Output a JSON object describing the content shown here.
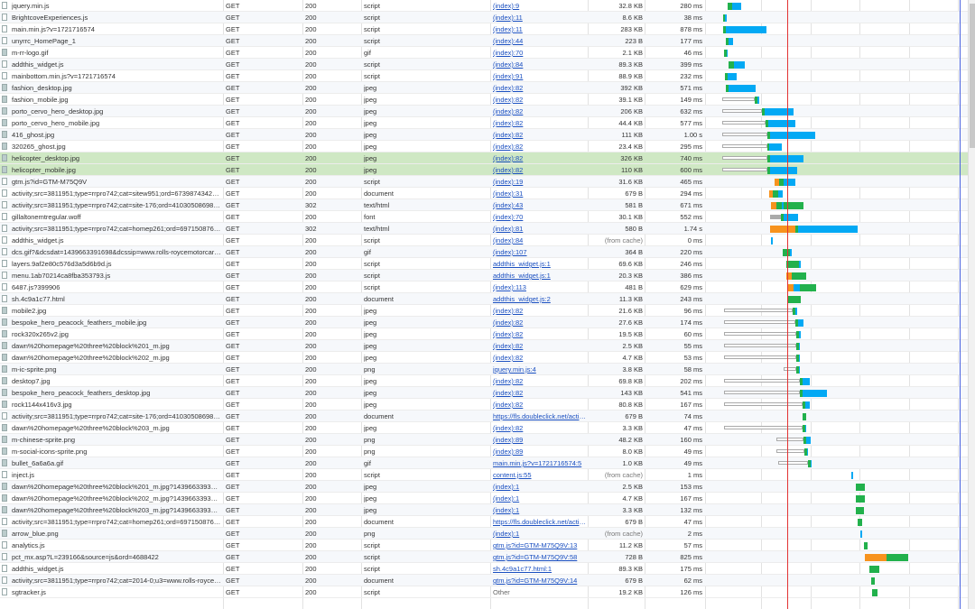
{
  "timeline": {
    "load_color": "#e33333",
    "dom_color": "#4a63e0"
  },
  "requests": [
    {
      "name": "jquery.min.js",
      "method": "GET",
      "status": "200",
      "type": "script",
      "initiator": "(index):9",
      "size": "32.8 KB",
      "time": "280 ms",
      "icon": "file-icon",
      "wf": {
        "s": 806,
        "w": 5,
        "r": 10
      }
    },
    {
      "name": "BrightcoveExperiences.js",
      "method": "GET",
      "status": "200",
      "type": "script",
      "initiator": "(index):11",
      "size": "8.6 KB",
      "time": "38 ms",
      "icon": "file-icon",
      "wf": {
        "s": 801,
        "w": 2,
        "r": 2
      }
    },
    {
      "name": "main.min.js?v=1721716574",
      "method": "GET",
      "status": "200",
      "type": "script",
      "initiator": "(index):11",
      "size": "283 KB",
      "time": "878 ms",
      "icon": "file-icon",
      "wf": {
        "s": 801,
        "w": 3,
        "r": 45
      }
    },
    {
      "name": "unyrrc_HomePage_1",
      "method": "GET",
      "status": "200",
      "type": "script",
      "initiator": "(index):44",
      "size": "223 B",
      "time": "177 ms",
      "icon": "file-icon",
      "wf": {
        "s": 804,
        "w": 3,
        "r": 5
      }
    },
    {
      "name": "m-rr-logo.gif",
      "method": "GET",
      "status": "200",
      "type": "gif",
      "initiator": "(index):70",
      "size": "2.1 KB",
      "time": "46 ms",
      "icon": "image-icon",
      "wf": {
        "s": 802,
        "w": 3,
        "r": 1
      }
    },
    {
      "name": "addthis_widget.js",
      "method": "GET",
      "status": "200",
      "type": "script",
      "initiator": "(index):84",
      "size": "89.3 KB",
      "time": "399 ms",
      "icon": "file-icon",
      "wf": {
        "s": 807,
        "w": 6,
        "r": 12
      }
    },
    {
      "name": "mainbottom.min.js?v=1721716574",
      "method": "GET",
      "status": "200",
      "type": "script",
      "initiator": "(index):91",
      "size": "88.9 KB",
      "time": "232 ms",
      "icon": "file-icon",
      "wf": {
        "s": 803,
        "w": 3,
        "r": 10
      }
    },
    {
      "name": "fashion_desktop.jpg",
      "method": "GET",
      "status": "200",
      "type": "jpeg",
      "initiator": "(index):82",
      "size": "392 KB",
      "time": "571 ms",
      "icon": "image-icon",
      "wf": {
        "s": 804,
        "w": 3,
        "r": 30
      }
    },
    {
      "name": "fashion_mobile.jpg",
      "method": "GET",
      "status": "200",
      "type": "jpeg",
      "initiator": "(index):82",
      "size": "39.1 KB",
      "time": "149 ms",
      "icon": "image-icon",
      "wf": {
        "s": 800,
        "p": 36,
        "w": 3,
        "r": 2
      }
    },
    {
      "name": "porto_cervo_hero_desktop.jpg",
      "method": "GET",
      "status": "200",
      "type": "jpeg",
      "initiator": "(index):82",
      "size": "206 KB",
      "time": "632 ms",
      "icon": "image-icon",
      "wf": {
        "s": 800,
        "p": 44,
        "w": 3,
        "r": 32
      }
    },
    {
      "name": "porto_cervo_hero_mobile.jpg",
      "method": "GET",
      "status": "200",
      "type": "jpeg",
      "initiator": "(index):82",
      "size": "44.4 KB",
      "time": "577 ms",
      "icon": "image-icon",
      "wf": {
        "s": 800,
        "p": 48,
        "w": 3,
        "r": 30
      }
    },
    {
      "name": "416_ghost.jpg",
      "method": "GET",
      "status": "200",
      "type": "jpeg",
      "initiator": "(index):82",
      "size": "111 KB",
      "time": "1.00 s",
      "icon": "image-icon",
      "wf": {
        "s": 800,
        "p": 50,
        "w": 3,
        "r": 50
      }
    },
    {
      "name": "320265_ghost.jpg",
      "method": "GET",
      "status": "200",
      "type": "jpeg",
      "initiator": "(index):82",
      "size": "23.4 KB",
      "time": "295 ms",
      "icon": "image-icon",
      "wf": {
        "s": 800,
        "p": 50,
        "w": 2,
        "r": 14
      }
    },
    {
      "name": "helicopter_desktop.jpg",
      "method": "GET",
      "status": "200",
      "type": "jpeg",
      "initiator": "(index):82",
      "size": "326 KB",
      "time": "740 ms",
      "icon": "image-icon",
      "hl": true,
      "wf": {
        "s": 800,
        "p": 50,
        "w": 3,
        "r": 37
      }
    },
    {
      "name": "helicopter_mobile.jpg",
      "method": "GET",
      "status": "200",
      "type": "jpeg",
      "initiator": "(index):82",
      "size": "110 KB",
      "time": "600 ms",
      "icon": "image-icon",
      "hl": true,
      "wf": {
        "s": 800,
        "p": 50,
        "w": 3,
        "r": 30
      }
    },
    {
      "name": "gtm.js?id=GTM-M75Q9V",
      "method": "GET",
      "status": "200",
      "type": "script",
      "initiator": "(index):19",
      "size": "31.6 KB",
      "time": "465 ms",
      "icon": "file-icon",
      "wf": {
        "s": 858,
        "w": 5,
        "o": 5,
        "r": 13
      }
    },
    {
      "name": "activity;src=3811951;type=rrpro742;cat=sitew951;ord=6739874342456.46",
      "method": "GET",
      "status": "200",
      "type": "document",
      "initiator": "(index):31",
      "size": "679 B",
      "time": "294 ms",
      "icon": "file-icon",
      "wf": {
        "s": 852,
        "o": 4,
        "w": 6,
        "r": 5
      }
    },
    {
      "name": "activity;src=3811951;type=rrpro742;cat=site-176;ord=4103050869889.95575",
      "method": "GET",
      "status": "302",
      "type": "text/html",
      "initiator": "(index):43",
      "size": "581 B",
      "time": "671 ms",
      "icon": "file-icon",
      "wf": {
        "s": 854,
        "o": 6,
        "w": 6,
        "r": 2,
        "w2": 22
      }
    },
    {
      "name": "gillaltonemtregular.woff",
      "method": "GET",
      "status": "200",
      "type": "font",
      "initiator": "(index):70",
      "size": "30.1 KB",
      "time": "552 ms",
      "icon": "file-icon",
      "wf": {
        "s": 853,
        "q": 12,
        "w": 3,
        "r": 16
      }
    },
    {
      "name": "activity;src=3811951;type=rrpro742;cat=homep261;ord=6971508769784...",
      "method": "GET",
      "status": "302",
      "type": "text/html",
      "initiator": "(index):81",
      "size": "580 B",
      "time": "1.74 s",
      "icon": "file-icon",
      "wf": {
        "s": 853,
        "o": 28,
        "w": 3,
        "r": 66
      }
    },
    {
      "name": "addthis_widget.js",
      "method": "GET",
      "status": "200",
      "type": "script",
      "initiator": "(index):84",
      "size": "(from cache)",
      "time": "0 ms",
      "icon": "file-icon",
      "cache": true,
      "wf": {
        "s": 854,
        "r": 2
      }
    },
    {
      "name": "dcs.gif?&dcsdat=1439663391698&dcssip=www.rolls-roycemotorcars.com...",
      "method": "GET",
      "status": "200",
      "type": "gif",
      "initiator": "(index):107",
      "size": "364 B",
      "time": "220 ms",
      "icon": "file-icon",
      "wf": {
        "s": 867,
        "w": 8,
        "r": 2
      }
    },
    {
      "name": "layers.9af2e80c576d3a5d6b9d.js",
      "method": "GET",
      "status": "200",
      "type": "script",
      "initiator": "addthis_widget.js:1",
      "size": "69.6 KB",
      "time": "246 ms",
      "icon": "file-icon",
      "wf": {
        "s": 871,
        "w": 14,
        "r": 2
      }
    },
    {
      "name": "menu.1ab70214ca8fba353793.js",
      "method": "GET",
      "status": "200",
      "type": "script",
      "initiator": "addthis_widget.js:1",
      "size": "20.3 KB",
      "time": "386 ms",
      "icon": "file-icon",
      "wf": {
        "s": 871,
        "o": 6,
        "w": 16
      }
    },
    {
      "name": "6487.js?399906",
      "method": "GET",
      "status": "200",
      "type": "script",
      "initiator": "(index):113",
      "size": "481 B",
      "time": "629 ms",
      "icon": "file-icon",
      "wf": {
        "s": 872,
        "o": 7,
        "r": 7,
        "w2": 18
      }
    },
    {
      "name": "sh.4c9a1c77.html",
      "method": "GET",
      "status": "200",
      "type": "document",
      "initiator": "addthis_widget.js:2",
      "size": "11.3 KB",
      "time": "243 ms",
      "icon": "file-icon",
      "wf": {
        "s": 872,
        "w": 15
      }
    },
    {
      "name": "mobile2.jpg",
      "method": "GET",
      "status": "200",
      "type": "jpeg",
      "initiator": "(index):82",
      "size": "21.6 KB",
      "time": "96 ms",
      "icon": "image-icon",
      "wf": {
        "s": 802,
        "p": 76,
        "w": 3,
        "r": 2
      }
    },
    {
      "name": "bespoke_hero_peacock_feathers_mobile.jpg",
      "method": "GET",
      "status": "200",
      "type": "jpeg",
      "initiator": "(index):82",
      "size": "27.6 KB",
      "time": "174 ms",
      "icon": "image-icon",
      "wf": {
        "s": 802,
        "p": 79,
        "w": 3,
        "r": 6
      }
    },
    {
      "name": "rock320x265v2.jpg",
      "method": "GET",
      "status": "200",
      "type": "jpeg",
      "initiator": "(index):82",
      "size": "19.5 KB",
      "time": "60 ms",
      "icon": "image-icon",
      "wf": {
        "s": 802,
        "p": 80,
        "w": 3,
        "r": 2
      }
    },
    {
      "name": "dawn%20homepage%20three%20block%201_m.jpg",
      "method": "GET",
      "status": "200",
      "type": "jpeg",
      "initiator": "(index):82",
      "size": "2.5 KB",
      "time": "55 ms",
      "icon": "image-icon",
      "wf": {
        "s": 802,
        "p": 80,
        "w": 3,
        "r": 1
      }
    },
    {
      "name": "dawn%20homepage%20three%20block%202_m.jpg",
      "method": "GET",
      "status": "200",
      "type": "jpeg",
      "initiator": "(index):82",
      "size": "4.7 KB",
      "time": "53 ms",
      "icon": "image-icon",
      "wf": {
        "s": 802,
        "p": 80,
        "w": 3,
        "r": 1
      }
    },
    {
      "name": "m-ic-sprite.png",
      "method": "GET",
      "status": "200",
      "type": "png",
      "initiator": "jquery.min.js:4",
      "size": "3.8 KB",
      "time": "58 ms",
      "icon": "image-icon",
      "wf": {
        "s": 868,
        "p": 14,
        "w": 3,
        "r": 1
      }
    },
    {
      "name": "desktop7.jpg",
      "method": "GET",
      "status": "200",
      "type": "jpeg",
      "initiator": "(index):82",
      "size": "69.8 KB",
      "time": "202 ms",
      "icon": "image-icon",
      "wf": {
        "s": 802,
        "p": 84,
        "w": 3,
        "r": 8
      }
    },
    {
      "name": "bespoke_hero_peacock_feathers_desktop.jpg",
      "method": "GET",
      "status": "200",
      "type": "jpeg",
      "initiator": "(index):82",
      "size": "143 KB",
      "time": "541 ms",
      "icon": "image-icon",
      "wf": {
        "s": 802,
        "p": 84,
        "w": 3,
        "r": 27
      }
    },
    {
      "name": "rock1144x416v3.jpg",
      "method": "GET",
      "status": "200",
      "type": "jpeg",
      "initiator": "(index):82",
      "size": "80.8 KB",
      "time": "167 ms",
      "icon": "image-icon",
      "wf": {
        "s": 802,
        "p": 87,
        "w": 3,
        "r": 5
      }
    },
    {
      "name": "activity;src=3811951;type=rrpro742;cat=site-176;ord=4103050869889.95575",
      "method": "GET",
      "status": "200",
      "type": "document",
      "initiator": "https://fls.doubleclick.net/activit...",
      "size": "679 B",
      "time": "74 ms",
      "icon": "file-icon",
      "wf": {
        "s": 889,
        "w": 4
      }
    },
    {
      "name": "dawn%20homepage%20three%20block%203_m.jpg",
      "method": "GET",
      "status": "200",
      "type": "jpeg",
      "initiator": "(index):82",
      "size": "3.3 KB",
      "time": "47 ms",
      "icon": "image-icon",
      "wf": {
        "s": 802,
        "p": 87,
        "w": 3,
        "r": 1
      }
    },
    {
      "name": "m-chinese-sprite.png",
      "method": "GET",
      "status": "200",
      "type": "png",
      "initiator": "(index):89",
      "size": "48.2 KB",
      "time": "160 ms",
      "icon": "image-icon",
      "wf": {
        "s": 860,
        "p": 30,
        "w": 3,
        "r": 5
      }
    },
    {
      "name": "m-social-icons-sprite.png",
      "method": "GET",
      "status": "200",
      "type": "png",
      "initiator": "(index):89",
      "size": "8.0 KB",
      "time": "49 ms",
      "icon": "image-icon",
      "wf": {
        "s": 860,
        "p": 31,
        "w": 3,
        "r": 1
      }
    },
    {
      "name": "bullet_6a6a6a.gif",
      "method": "GET",
      "status": "200",
      "type": "gif",
      "initiator": "main.min.js?v=1721716574:5",
      "size": "1.0 KB",
      "time": "49 ms",
      "icon": "image-icon",
      "wf": {
        "s": 862,
        "p": 33,
        "w": 3,
        "r": 1
      }
    },
    {
      "name": "inject.js",
      "method": "GET",
      "status": "200",
      "type": "script",
      "initiator": "content.js:55",
      "size": "(from cache)",
      "time": "1 ms",
      "icon": "file-icon",
      "cache": true,
      "wf": {
        "s": 943,
        "r": 2
      }
    },
    {
      "name": "dawn%20homepage%20three%20block%201_m.jpg?1439663393172",
      "method": "GET",
      "status": "200",
      "type": "jpeg",
      "initiator": "(index):1",
      "size": "2.5 KB",
      "time": "153 ms",
      "icon": "image-icon",
      "wf": {
        "s": 948,
        "w": 10
      }
    },
    {
      "name": "dawn%20homepage%20three%20block%202_m.jpg?1439663393173",
      "method": "GET",
      "status": "200",
      "type": "jpeg",
      "initiator": "(index):1",
      "size": "4.7 KB",
      "time": "167 ms",
      "icon": "image-icon",
      "wf": {
        "s": 948,
        "w": 10
      }
    },
    {
      "name": "dawn%20homepage%20three%20block%203_m.jpg?1439663393175",
      "method": "GET",
      "status": "200",
      "type": "jpeg",
      "initiator": "(index):1",
      "size": "3.3 KB",
      "time": "132 ms",
      "icon": "image-icon",
      "wf": {
        "s": 948,
        "w": 9
      }
    },
    {
      "name": "activity;src=3811951;type=rrpro742;cat=homep261;ord=6971508769784...",
      "method": "GET",
      "status": "200",
      "type": "document",
      "initiator": "https://fls.doubleclick.net/activit...",
      "size": "679 B",
      "time": "47 ms",
      "icon": "file-icon",
      "wf": {
        "s": 950,
        "w": 5
      }
    },
    {
      "name": "arrow_blue.png",
      "method": "GET",
      "status": "200",
      "type": "png",
      "initiator": "(index):1",
      "size": "(from cache)",
      "time": "2 ms",
      "icon": "image-icon",
      "cache": true,
      "wf": {
        "s": 953,
        "r": 2
      }
    },
    {
      "name": "analytics.js",
      "method": "GET",
      "status": "200",
      "type": "script",
      "initiator": "gtm.js?id=GTM-M75Q9V:13",
      "size": "11.2 KB",
      "time": "57 ms",
      "icon": "file-icon",
      "wf": {
        "s": 957,
        "w": 4
      }
    },
    {
      "name": "pct_mx.asp?L=239166&source=js&ord=4688422",
      "method": "GET",
      "status": "200",
      "type": "script",
      "initiator": "gtm.js?id=GTM-M75Q9V:58",
      "size": "728 B",
      "time": "825 ms",
      "icon": "file-icon",
      "wf": {
        "s": 958,
        "o": 24,
        "w": 24
      }
    },
    {
      "name": "addthis_widget.js",
      "method": "GET",
      "status": "200",
      "type": "script",
      "initiator": "sh.4c9a1c77.html:1",
      "size": "89.3 KB",
      "time": "175 ms",
      "icon": "file-icon",
      "wf": {
        "s": 963,
        "w": 11
      }
    },
    {
      "name": "activity;src=3811951;type=rrpro742;cat=2014-0;u3=www.rolls-roycemoto...",
      "method": "GET",
      "status": "200",
      "type": "document",
      "initiator": "gtm.js?id=GTM-M75Q9V:14",
      "size": "679 B",
      "time": "62 ms",
      "icon": "file-icon",
      "wf": {
        "s": 965,
        "w": 4
      }
    },
    {
      "name": "sgtracker.js",
      "method": "GET",
      "status": "200",
      "type": "script",
      "initiator": "Other",
      "size": "19.2 KB",
      "time": "126 ms",
      "icon": "file-icon",
      "plain": true,
      "wf": {
        "s": 966,
        "w": 6
      }
    }
  ]
}
